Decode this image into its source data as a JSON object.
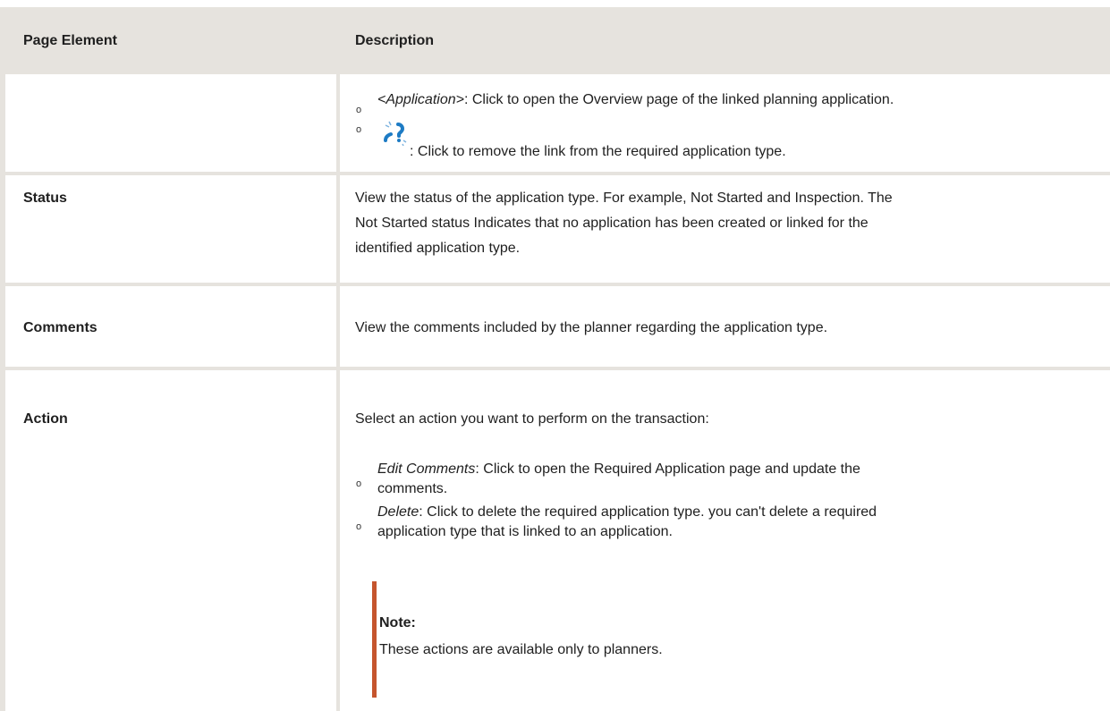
{
  "table": {
    "col1_header": "Page Element",
    "col2_header": "Description"
  },
  "row_link": {
    "bullet1_term": "<Application>",
    "bullet1_text": ": Click to open the Overview page of the linked planning application.",
    "bullet2_icon": "unlink-icon",
    "bullet2_text": ": Click to remove the link from the required application type."
  },
  "row_status": {
    "label": "Status",
    "line1": "View the status of the application type. For example, Not Started and Inspection. The",
    "line2": "Not Started status Indicates that no application has been created or linked for the",
    "line3": "identified application type."
  },
  "row_comments": {
    "label": "Comments",
    "text": "View the comments included by the planner regarding the application type."
  },
  "row_action": {
    "label": "Action",
    "intro": "Select an action you want to perform on the transaction:",
    "item1_term": "Edit Comments",
    "item1_line1": ": Click to open the Required Application page and update the",
    "item1_line2": "comments.",
    "item2_term": "Delete",
    "item2_line1": ": Click to delete the required application type. you can't delete a required",
    "item2_line2": "application type that is linked to an application.",
    "note_title": "Note:",
    "note_text": "These actions are available only to planners."
  },
  "colors": {
    "border": "#e6e3de",
    "note_bar": "#c5552e",
    "icon_blue": "#1d7bc4"
  }
}
